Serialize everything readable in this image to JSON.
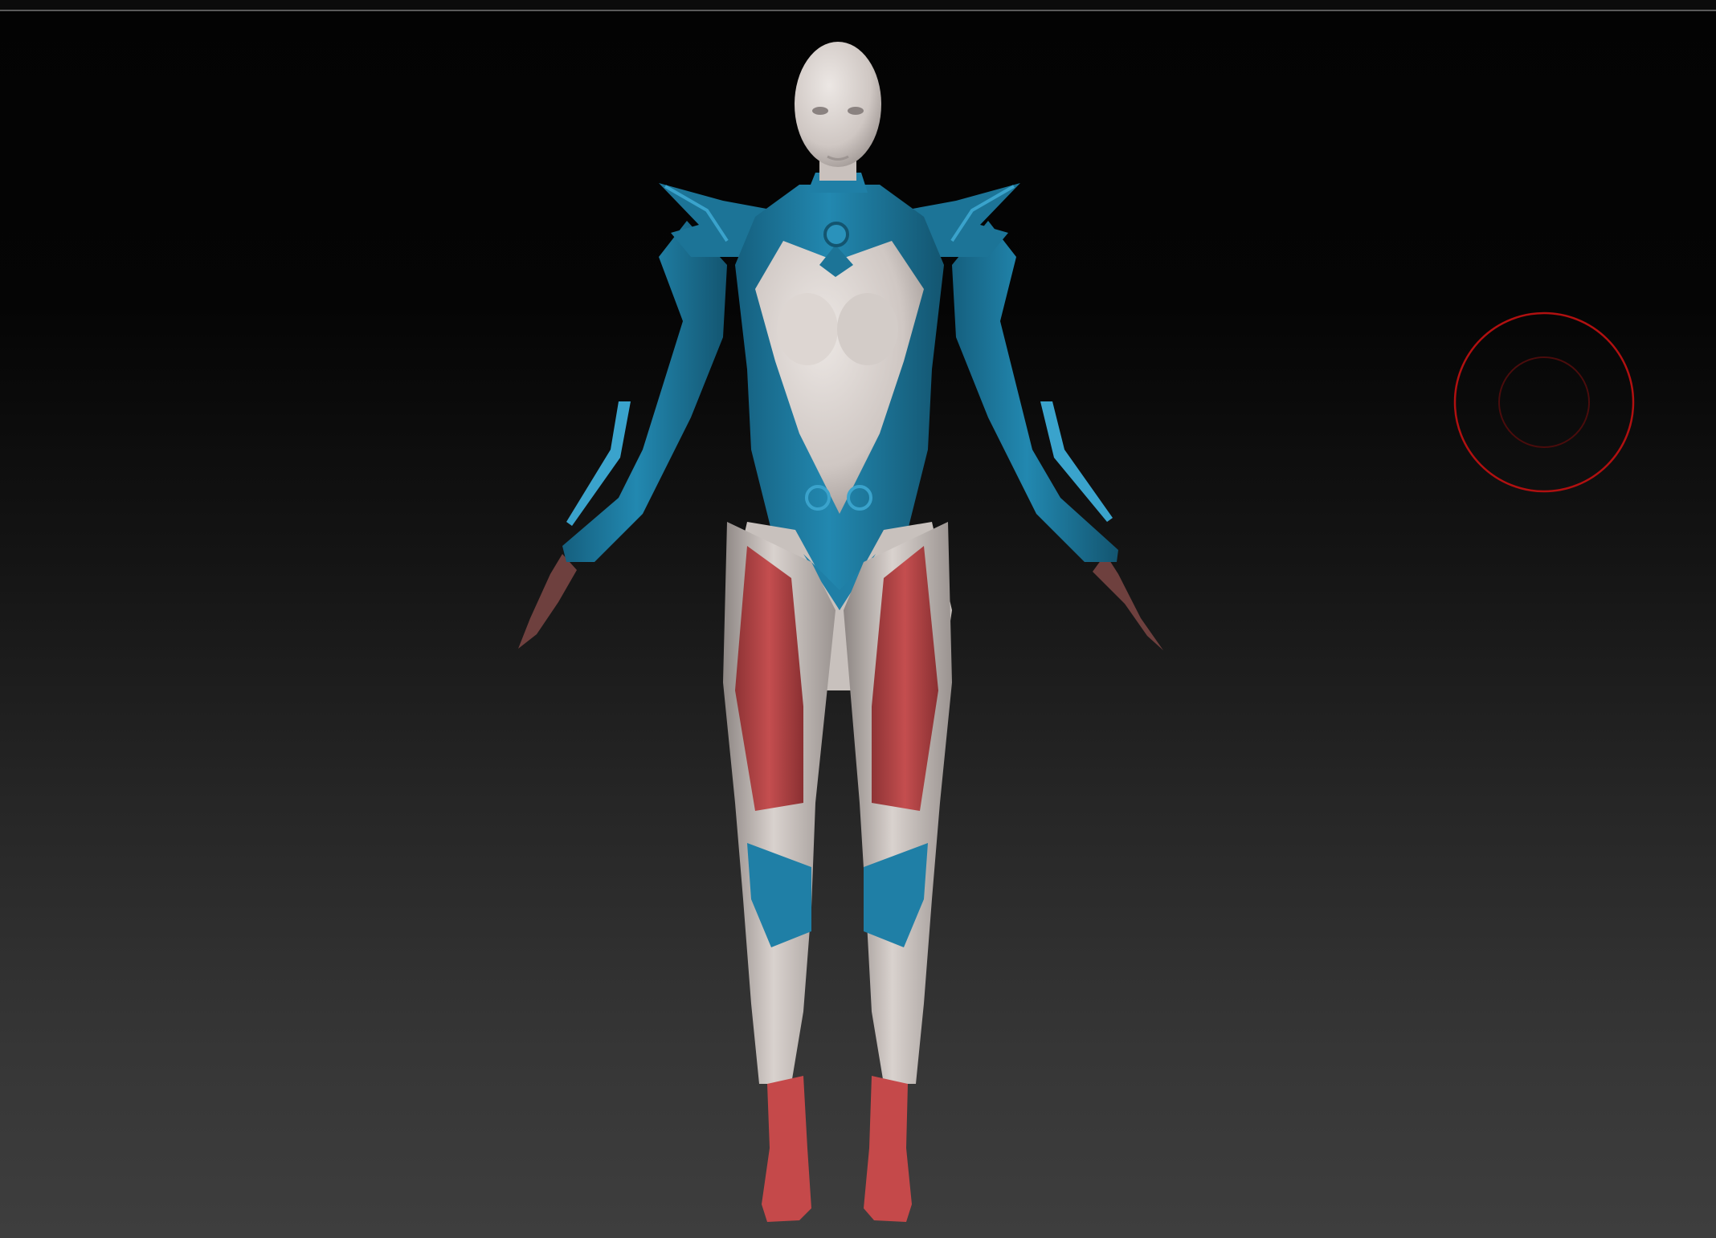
{
  "viewport": {
    "background_top": "#030303",
    "background_bottom": "#3e3e3e",
    "frame_line": "#5a5a5a"
  },
  "model": {
    "skin_color": "#d2cbc7",
    "armor_primary": "#1f7fa6",
    "armor_highlight": "#3aa3cc",
    "leg_panel": "#b8484a",
    "boot": "#c5494a",
    "hand": "#7a4845"
  },
  "brush_cursor": {
    "icon": "brush-radius-icon",
    "outer_color": "#b01010",
    "inner_color": "#4a0c0c"
  }
}
